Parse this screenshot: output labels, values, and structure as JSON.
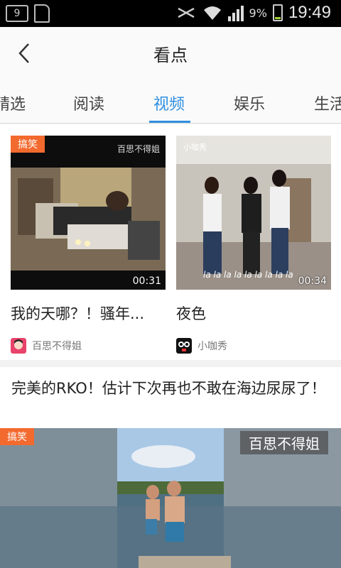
{
  "status_bar": {
    "notification_count": "9",
    "battery_percent": "9%",
    "time": "19:49"
  },
  "app_bar": {
    "title": "看点"
  },
  "tabs": [
    {
      "label": "精选",
      "active": false
    },
    {
      "label": "阅读",
      "active": false
    },
    {
      "label": "视频",
      "active": true
    },
    {
      "label": "娱乐",
      "active": false
    },
    {
      "label": "生活",
      "active": false
    }
  ],
  "videos": [
    {
      "badge": "搞笑",
      "watermark": "百思不得姐",
      "duration": "00:31",
      "title": "我的天哪？！骚年...",
      "source": "百思不得姐"
    },
    {
      "badge": "",
      "watermark": "小咖秀",
      "duration": "00:34",
      "title": "夜色",
      "source": "小咖秀",
      "caption": "la la la la la la la la la"
    }
  ],
  "featured": {
    "title": "完美的RKO！估计下次再也不敢在海边尿尿了！",
    "badge": "搞笑",
    "watermark": "百思不得姐"
  },
  "colors": {
    "accent": "#2f8fe0",
    "badge": "#f36a2e",
    "status_bar": "#000000"
  }
}
